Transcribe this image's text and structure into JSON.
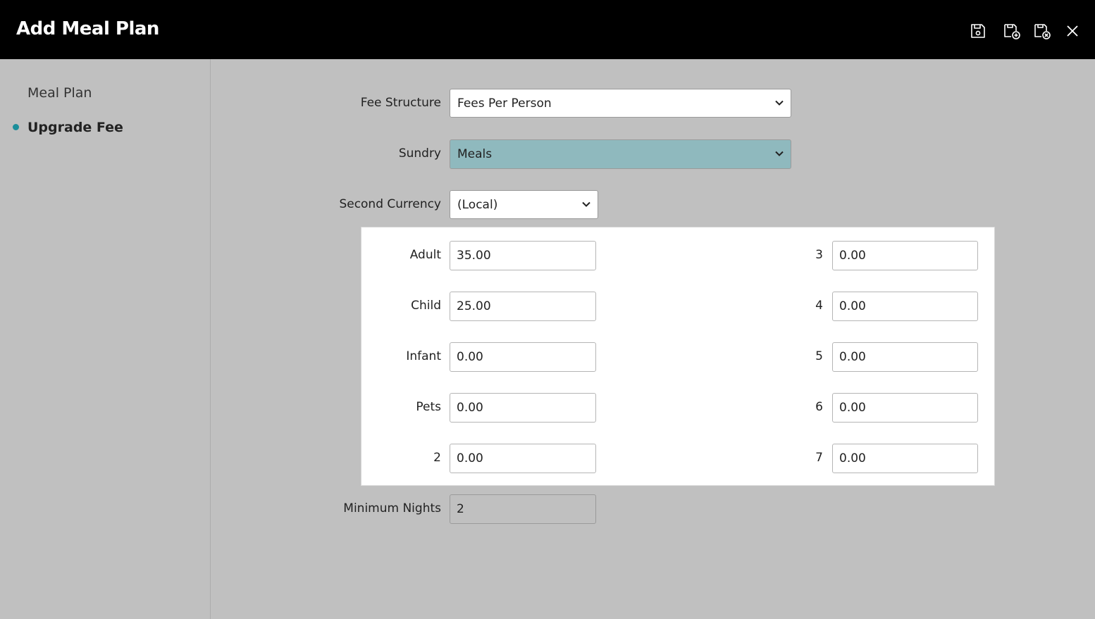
{
  "window": {
    "title": "Add Meal Plan",
    "icons": [
      "save-icon",
      "save-and-new-icon",
      "save-and-close-icon",
      "close-icon"
    ]
  },
  "sidebar": {
    "items": [
      {
        "label": "Meal Plan",
        "active": false
      },
      {
        "label": "Upgrade Fee",
        "active": true
      }
    ]
  },
  "form": {
    "fee_structure": {
      "label": "Fee Structure",
      "value": "Fees Per Person"
    },
    "sundry": {
      "label": "Sundry",
      "value": "Meals"
    },
    "second_currency": {
      "label": "Second Currency",
      "value": "(Local)"
    },
    "fees_left": [
      {
        "label": "Adult",
        "value": "35.00"
      },
      {
        "label": "Child",
        "value": "25.00"
      },
      {
        "label": "Infant",
        "value": "0.00"
      },
      {
        "label": "Pets",
        "value": "0.00"
      },
      {
        "label": "2",
        "value": "0.00"
      }
    ],
    "fees_right": [
      {
        "label": "3",
        "value": "0.00"
      },
      {
        "label": "4",
        "value": "0.00"
      },
      {
        "label": "5",
        "value": "0.00"
      },
      {
        "label": "6",
        "value": "0.00"
      },
      {
        "label": "7",
        "value": "0.00"
      }
    ],
    "minimum_nights": {
      "label": "Minimum Nights",
      "value": "2"
    }
  },
  "colors": {
    "topbar": "#000000",
    "background": "#c0c0c0",
    "accent": "#1b8e9a",
    "highlight_select": "#8fb9be"
  }
}
